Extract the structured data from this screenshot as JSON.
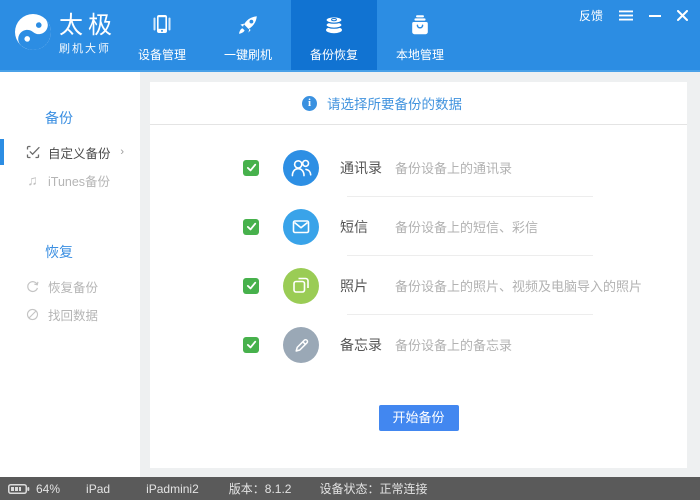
{
  "logo": {
    "title": "太极",
    "subtitle": "刷机大师"
  },
  "nav": {
    "tabs": [
      {
        "label": "设备管理",
        "icon": "device-icon",
        "active": false
      },
      {
        "label": "一键刷机",
        "icon": "flash-rocket-icon",
        "active": false
      },
      {
        "label": "备份恢复",
        "icon": "backup-database-icon",
        "active": true
      },
      {
        "label": "本地管理",
        "icon": "local-bag-icon",
        "active": false
      }
    ]
  },
  "window_controls": {
    "feedback_label": "反馈",
    "icons": {
      "menu": "≡",
      "minimize": "−",
      "close": "✕"
    }
  },
  "sidebar": {
    "sections": [
      {
        "title": "备份",
        "items": [
          {
            "label": "自定义备份",
            "icon": "custom-backup-icon",
            "active": true,
            "chevron": "›"
          },
          {
            "label": "iTunes备份",
            "icon": "itunes-note-icon",
            "glyph": "♫",
            "active": false
          }
        ]
      },
      {
        "title": "恢复",
        "items": [
          {
            "label": "恢复备份",
            "icon": "restore-icon",
            "active": false
          },
          {
            "label": "找回数据",
            "icon": "retrieve-data-icon",
            "active": false
          }
        ]
      }
    ]
  },
  "main": {
    "prompt": "请选择所要备份的数据",
    "info_glyph": "i",
    "items": [
      {
        "label": "通讯录",
        "desc": "备份设备上的通讯录",
        "checked": true,
        "icon": "contacts-icon",
        "color": "#2d8fe4"
      },
      {
        "label": "短信",
        "desc": "备份设备上的短信、彩信",
        "checked": true,
        "icon": "sms-icon",
        "color": "#39a3e9"
      },
      {
        "label": "照片",
        "desc": "备份设备上的照片、视频及电脑导入的照片",
        "checked": true,
        "icon": "photos-icon",
        "color": "#9acc55"
      },
      {
        "label": "备忘录",
        "desc": "备份设备上的备忘录",
        "checked": true,
        "icon": "notes-icon",
        "color": "#9aa8b6"
      }
    ],
    "start_button": "开始备份"
  },
  "statusbar": {
    "battery_percent": "64%",
    "device": "iPad",
    "model": "iPadmini2",
    "version_label": "版本：8.1.2",
    "status_label": "设备状态：正常连接"
  },
  "colors": {
    "header_bg": "#2c8de3",
    "header_underline": "#4aa1e8",
    "active_tab_bg": "#1173d2",
    "sidebar_accent": "#3b8fe2",
    "active_indicator": "#2c8de3",
    "info_text": "#4193de",
    "checkbox_green": "#47b14c",
    "button_bg": "#4287f0",
    "statusbar_bg": "#5a5a5a",
    "panel_bg": "#ffffff",
    "app_bg": "#eef0f1"
  }
}
